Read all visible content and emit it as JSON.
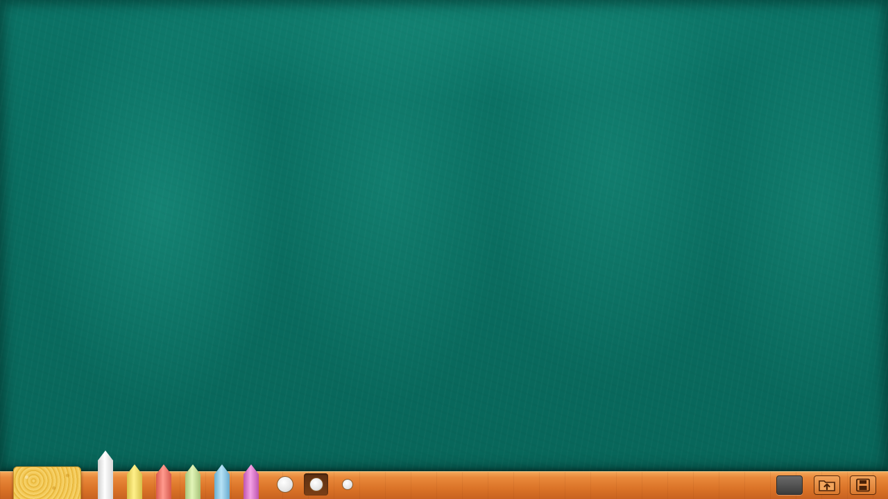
{
  "app": {
    "board_color": "#0a6d60",
    "tray_color": "#e9893b"
  },
  "eraser": {
    "icon": "sponge-eraser-icon"
  },
  "chalks": [
    {
      "name": "white",
      "color": "#f4f4f4",
      "selected": true
    },
    {
      "name": "yellow",
      "color": "#f0df6a",
      "selected": false
    },
    {
      "name": "red",
      "color": "#ef7b6e",
      "selected": false
    },
    {
      "name": "green",
      "color": "#c9e39a",
      "selected": false
    },
    {
      "name": "blue",
      "color": "#8fcbe8",
      "selected": false
    },
    {
      "name": "pink",
      "color": "#e07ad0",
      "selected": false
    }
  ],
  "brush_sizes": [
    {
      "name": "large",
      "selected": false
    },
    {
      "name": "medium",
      "selected": true
    },
    {
      "name": "small",
      "selected": false
    }
  ],
  "toolbar": {
    "clear_board_icon": "blackboard-icon",
    "open_icon": "folder-upload-icon",
    "save_icon": "floppy-disk-icon"
  }
}
